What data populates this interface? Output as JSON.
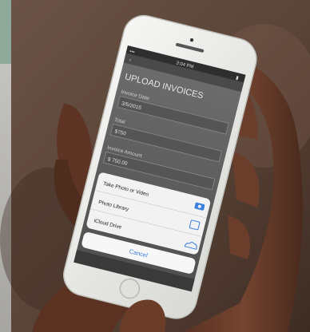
{
  "phone": {
    "status_bar": {
      "carrier": "•••",
      "time": "3:04 PM",
      "battery": "▮"
    },
    "page_title": "UPLOAD INVOICES",
    "fields": [
      {
        "label": "Invoice Date",
        "value": "3/5/2015"
      },
      {
        "label": "Total",
        "value": "$750"
      },
      {
        "label": "Invoice Amount",
        "value": "$ 750.00"
      }
    ],
    "action_sheet": {
      "options": [
        {
          "label": "Take Photo or Video",
          "icon": "camera-icon"
        },
        {
          "label": "Photo Library",
          "icon": "photos-icon"
        },
        {
          "label": "iCloud Drive",
          "icon": "cloud-icon"
        }
      ],
      "cancel_label": "Cancel"
    }
  },
  "colors": {
    "ios_blue": "#3b7fe0",
    "phone_bezel": "#ececec",
    "screen_bg": "#5f5f5f",
    "background": "#5a4338"
  }
}
